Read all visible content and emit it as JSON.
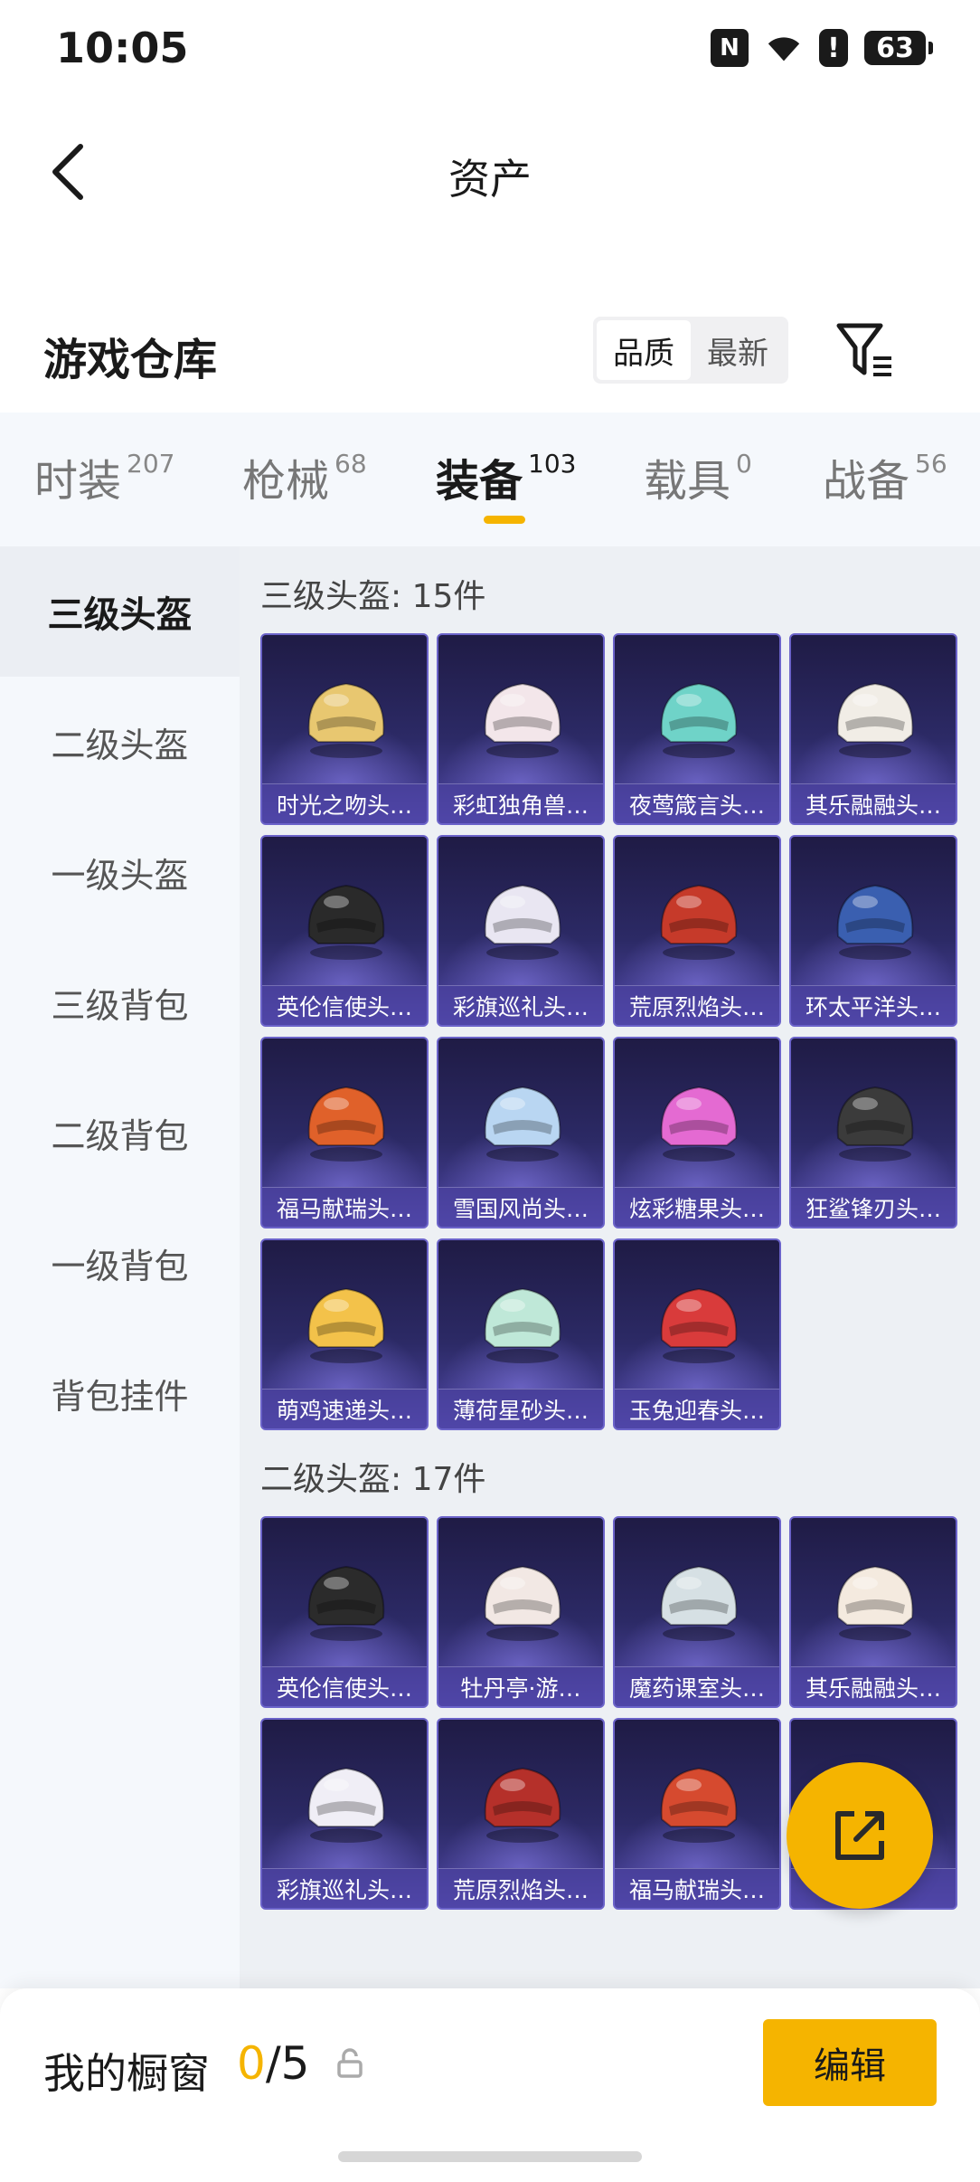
{
  "status": {
    "time": "10:05",
    "battery": "63"
  },
  "header": {
    "title": "资产"
  },
  "warehouse": {
    "title": "游戏仓库",
    "sort_options": [
      "品质",
      "最新"
    ],
    "active_sort": "品质"
  },
  "tabs": [
    {
      "label": "时装",
      "count": "207"
    },
    {
      "label": "枪械",
      "count": "68"
    },
    {
      "label": "装备",
      "count": "103",
      "active": true
    },
    {
      "label": "载具",
      "count": "0"
    },
    {
      "label": "战备",
      "count": "56"
    }
  ],
  "sidebar": [
    {
      "label": "三级头盔",
      "active": true
    },
    {
      "label": "二级头盔"
    },
    {
      "label": "一级头盔"
    },
    {
      "label": "三级背包"
    },
    {
      "label": "二级背包"
    },
    {
      "label": "一级背包"
    },
    {
      "label": "背包挂件"
    }
  ],
  "groups": [
    {
      "title": "三级头盔: 15件",
      "items": [
        "时光之吻头…",
        "彩虹独角兽…",
        "夜莺箴言头…",
        "其乐融融头…",
        "英伦信使头…",
        "彩旗巡礼头…",
        "荒原烈焰头…",
        "环太平洋头…",
        "福马献瑞头…",
        "雪国风尚头…",
        "炫彩糖果头…",
        "狂鲨锋刃头…",
        "萌鸡速递头…",
        "薄荷星砂头…",
        "玉兔迎春头…"
      ]
    },
    {
      "title": "二级头盔: 17件",
      "items": [
        "英伦信使头…",
        "牡丹亭·游…",
        "魔药课室头…",
        "其乐融融头…",
        "彩旗巡礼头…",
        "荒原烈焰头…",
        "福马献瑞头…",
        ""
      ]
    }
  ],
  "showcase": {
    "label": "我的橱窗",
    "current": "0",
    "total": "/5",
    "edit_label": "编辑"
  },
  "colors": {
    "accent": "#f5b400",
    "card_bg": "#2c2a66",
    "card_border": "#6b63c9"
  },
  "helmet_colors": [
    "#e8c770",
    "#f3e6ea",
    "#6fd3c8",
    "#f1ede6",
    "#2a2a2a",
    "#e9e6f2",
    "#c63a2a",
    "#3a5fb0",
    "#e0612a",
    "#b9d6f2",
    "#e46ad2",
    "#3b3b3b",
    "#f3c24a",
    "#bfe8d8",
    "#d93b3b",
    "#2b2b2b",
    "#f2e8e4",
    "#d6e0e4",
    "#f4eadf",
    "#f0eef6",
    "#b5302a",
    "#d64a2f",
    "#a3d8f2"
  ]
}
